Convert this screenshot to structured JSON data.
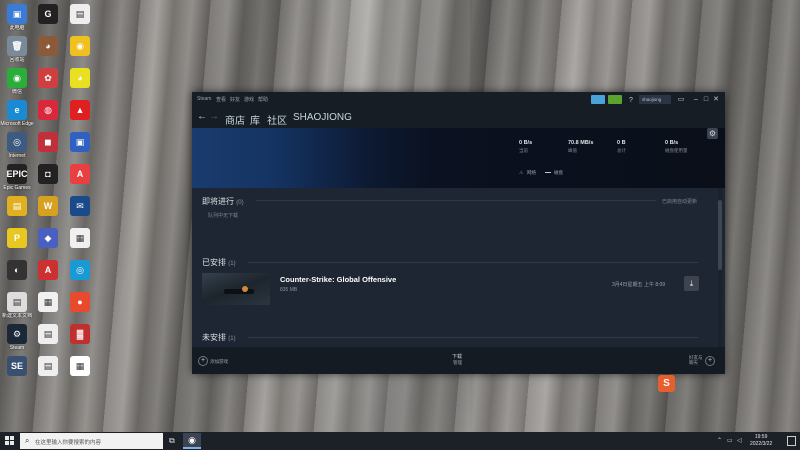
{
  "desktop": {
    "icons": [
      {
        "label": "此电脑",
        "color": "#3a7bd5",
        "glyph": "▣"
      },
      {
        "label": "回收站",
        "color": "#7a8a99",
        "glyph": "🗑"
      },
      {
        "label": "微信",
        "color": "#2aae3a",
        "glyph": "◉"
      },
      {
        "label": "Microsoft Edge",
        "color": "#1a8ad4",
        "glyph": "e"
      },
      {
        "label": "Internet",
        "color": "#3d5a80",
        "glyph": "◎"
      },
      {
        "label": "Epic Games",
        "color": "#222222",
        "glyph": "EPIC"
      },
      {
        "label": "",
        "color": "#e0b020",
        "glyph": "▤"
      },
      {
        "label": "",
        "color": "#e8c820",
        "glyph": "P"
      },
      {
        "label": "",
        "color": "#333333",
        "glyph": "◐"
      },
      {
        "label": "新建文本文档",
        "color": "#dddddd",
        "glyph": "▤"
      },
      {
        "label": "Steam",
        "color": "#1b2838",
        "glyph": "⚙"
      },
      {
        "label": "",
        "color": "#3a5070",
        "glyph": "SE"
      },
      {
        "label": "",
        "color": "#222222",
        "glyph": "G"
      },
      {
        "label": "",
        "color": "#8b5a3a",
        "glyph": "◕"
      },
      {
        "label": "",
        "color": "#cc4040",
        "glyph": "✿"
      },
      {
        "label": "",
        "color": "#d8283a",
        "glyph": "◍"
      },
      {
        "label": "",
        "color": "#c0303a",
        "glyph": "◼"
      },
      {
        "label": "",
        "color": "#222222",
        "glyph": "◘"
      },
      {
        "label": "",
        "color": "#d8a020",
        "glyph": "W"
      },
      {
        "label": "",
        "color": "#4a60c0",
        "glyph": "◆"
      },
      {
        "label": "",
        "color": "#cc3030",
        "glyph": "A"
      },
      {
        "label": "",
        "color": "#f0f0f0",
        "glyph": "▦"
      },
      {
        "label": "",
        "color": "#eeeeee",
        "glyph": "▤"
      },
      {
        "label": "",
        "color": "#eeeeee",
        "glyph": "▤"
      },
      {
        "label": "",
        "color": "#eeeeee",
        "glyph": "▤"
      },
      {
        "label": "",
        "color": "#f0c020",
        "glyph": "◉"
      },
      {
        "label": "",
        "color": "#e8e020",
        "glyph": "◕"
      },
      {
        "label": "",
        "color": "#e02020",
        "glyph": "▲"
      },
      {
        "label": "",
        "color": "#3060c0",
        "glyph": "▣"
      },
      {
        "label": "",
        "color": "#e84040",
        "glyph": "A"
      },
      {
        "label": "",
        "color": "#1a4a8a",
        "glyph": "✉"
      },
      {
        "label": "",
        "color": "#f0f0f0",
        "glyph": "▦"
      },
      {
        "label": "",
        "color": "#1a9ad4",
        "glyph": "◎"
      },
      {
        "label": "",
        "color": "#e84a30",
        "glyph": "●"
      },
      {
        "label": "",
        "color": "#c03030",
        "glyph": "▓"
      },
      {
        "label": "",
        "color": "#ffffff",
        "glyph": "▦"
      }
    ]
  },
  "steam": {
    "menu": [
      "Steam",
      "查看",
      "好友",
      "游戏",
      "帮助"
    ],
    "user": "shaojiong",
    "nav": {
      "store": "商店",
      "library": "库",
      "community": "社区",
      "profile": "SHAOJIONG"
    },
    "stats": [
      {
        "value": "0 B/s",
        "label": "当前"
      },
      {
        "value": "70.8 MB/s",
        "label": "峰值"
      },
      {
        "value": "0 B",
        "label": "总计"
      },
      {
        "value": "0 B/s",
        "label": "磁盘使用量"
      }
    ],
    "legend": {
      "network": "网络",
      "disk": "磁盘"
    },
    "sections": {
      "upcoming": {
        "title": "即将进行",
        "count": "(0)",
        "empty": "队列中无下载",
        "auto": "已启用自动更新"
      },
      "scheduled": {
        "title": "已安排",
        "count": "(1)"
      },
      "unscheduled": {
        "title": "未安排",
        "count": "(1)"
      }
    },
    "game": {
      "name": "Counter-Strike: Global Offensive",
      "size": "835 MB",
      "time": "3月4日星期五 上午 8:09"
    },
    "footer": {
      "add_game": "添加游戏",
      "downloads": "下载",
      "downloads_sub": "管理",
      "friends": "好友与聊天"
    }
  },
  "taskbar": {
    "search_placeholder": "在这里输入你要搜索的内容",
    "time": "19:59",
    "date": "2022/3/22"
  }
}
